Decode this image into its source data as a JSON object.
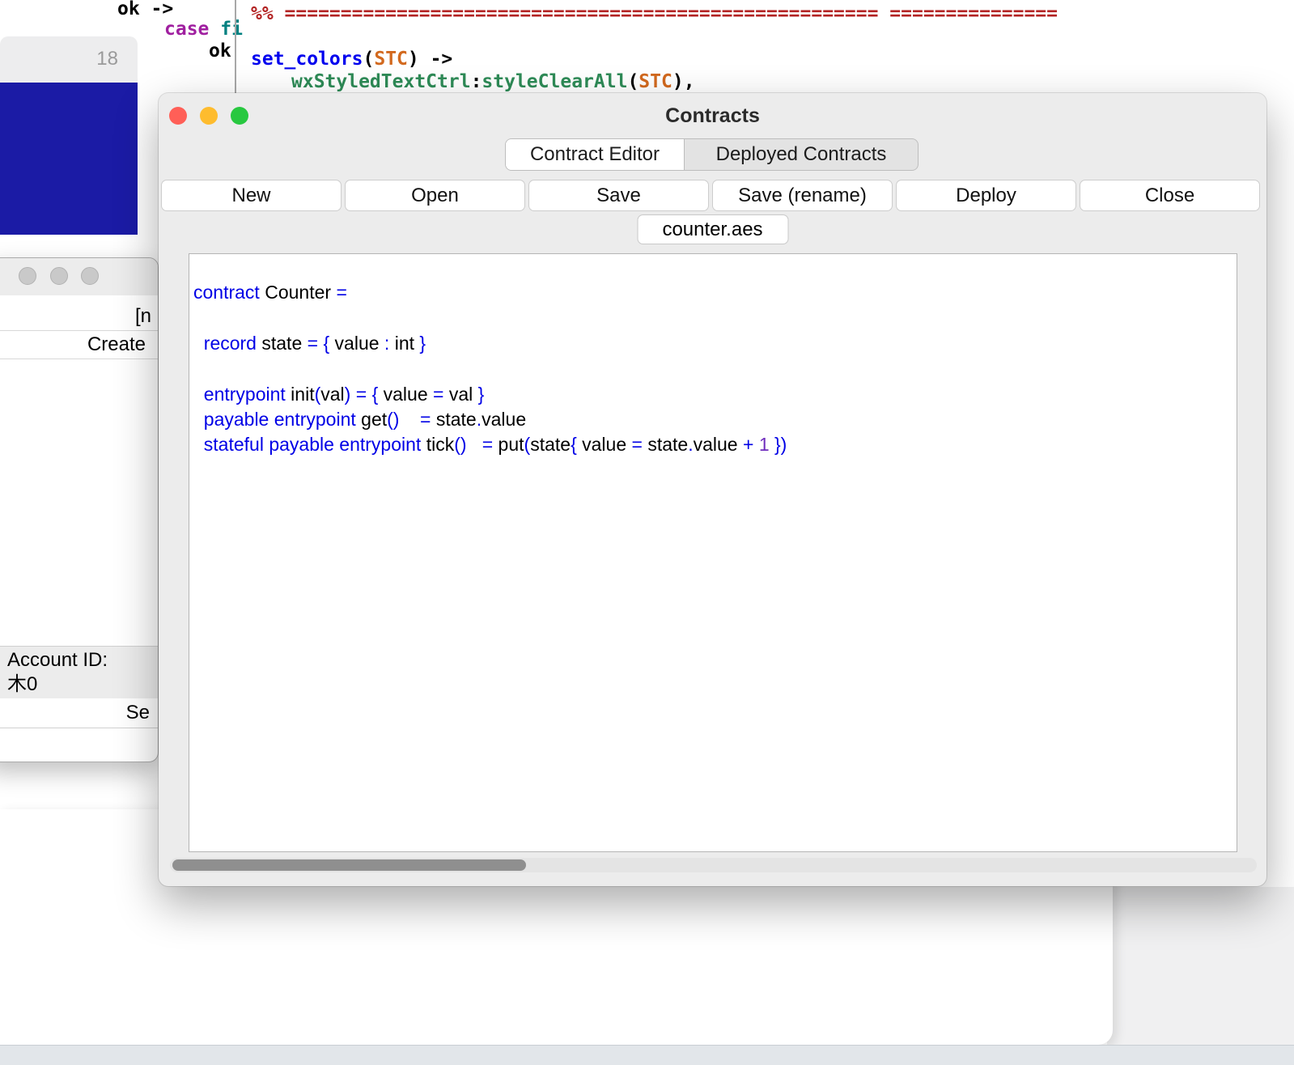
{
  "colors": {
    "sophia_keyword_operator": "#0000e6",
    "sophia_number": "#6f2dbd",
    "erlang_comment": "#b22222",
    "erlang_function": "#0000ee",
    "erlang_variable": "#d2691e",
    "erlang_module": "#2e8b57",
    "erlang_keyword": "#a020a0",
    "erlang_atom": "#008080",
    "traffic_red": "#ff5f57",
    "traffic_yellow": "#febc2e",
    "traffic_green": "#28c840",
    "navy_panel": "#1b1ba5"
  },
  "background_code": {
    "line_number": "18",
    "ok1": "ok ->",
    "ok2": "ok",
    "case_line": [
      {
        "t": "ekw",
        "s": "case"
      },
      {
        "t": "epl",
        "s": " "
      },
      {
        "t": "eatom",
        "s": "fi"
      }
    ],
    "comment_line": [
      {
        "t": "ecom",
        "s": "%% ===================================================== ==============="
      }
    ],
    "set_colors_line": [
      {
        "t": "efn",
        "s": "set_colors"
      },
      {
        "t": "epl",
        "s": "("
      },
      {
        "t": "evar",
        "s": "STC"
      },
      {
        "t": "epl",
        "s": ") ->"
      }
    ],
    "wx_call_line": [
      {
        "t": "emod",
        "s": "wxStyledTextCtrl"
      },
      {
        "t": "epl",
        "s": ":"
      },
      {
        "t": "emod",
        "s": "styleClearAll"
      },
      {
        "t": "epl",
        "s": "("
      },
      {
        "t": "evar",
        "s": "STC"
      },
      {
        "t": "epl",
        "s": "),"
      }
    ]
  },
  "accounts": {
    "partial_text": "[n",
    "create_label": "Create",
    "account_id_label": "Account ID:",
    "account_id_value": "木0",
    "send_partial_label": "Se"
  },
  "contracts": {
    "title": "Contracts",
    "tab_editor": "Contract Editor",
    "tab_deployed": "Deployed Contracts",
    "toolbar": {
      "new": "New",
      "open": "Open",
      "save": "Save",
      "save_rename": "Save (rename)",
      "deploy": "Deploy",
      "close": "Close"
    },
    "file_tab": "counter.aes",
    "code": [
      [
        {
          "t": "kw",
          "s": "contract"
        },
        {
          "t": "pl",
          "s": " Counter "
        },
        {
          "t": "op",
          "s": "="
        }
      ],
      [],
      [
        {
          "t": "pl",
          "s": "  "
        },
        {
          "t": "kw",
          "s": "record"
        },
        {
          "t": "pl",
          "s": " state "
        },
        {
          "t": "op",
          "s": "="
        },
        {
          "t": "pl",
          "s": " "
        },
        {
          "t": "op",
          "s": "{"
        },
        {
          "t": "pl",
          "s": " value "
        },
        {
          "t": "op",
          "s": ":"
        },
        {
          "t": "pl",
          "s": " int "
        },
        {
          "t": "op",
          "s": "}"
        }
      ],
      [],
      [
        {
          "t": "pl",
          "s": "  "
        },
        {
          "t": "kw",
          "s": "entrypoint"
        },
        {
          "t": "pl",
          "s": " init"
        },
        {
          "t": "op",
          "s": "("
        },
        {
          "t": "pl",
          "s": "val"
        },
        {
          "t": "op",
          "s": ")"
        },
        {
          "t": "pl",
          "s": " "
        },
        {
          "t": "op",
          "s": "="
        },
        {
          "t": "pl",
          "s": " "
        },
        {
          "t": "op",
          "s": "{"
        },
        {
          "t": "pl",
          "s": " value "
        },
        {
          "t": "op",
          "s": "="
        },
        {
          "t": "pl",
          "s": " val "
        },
        {
          "t": "op",
          "s": "}"
        }
      ],
      [
        {
          "t": "pl",
          "s": "  "
        },
        {
          "t": "kw",
          "s": "payable"
        },
        {
          "t": "pl",
          "s": " "
        },
        {
          "t": "kw",
          "s": "entrypoint"
        },
        {
          "t": "pl",
          "s": " get"
        },
        {
          "t": "op",
          "s": "()"
        },
        {
          "t": "pl",
          "s": "    "
        },
        {
          "t": "op",
          "s": "="
        },
        {
          "t": "pl",
          "s": " state"
        },
        {
          "t": "op",
          "s": "."
        },
        {
          "t": "pl",
          "s": "value"
        }
      ],
      [
        {
          "t": "pl",
          "s": "  "
        },
        {
          "t": "kw",
          "s": "stateful"
        },
        {
          "t": "pl",
          "s": " "
        },
        {
          "t": "kw",
          "s": "payable"
        },
        {
          "t": "pl",
          "s": " "
        },
        {
          "t": "kw",
          "s": "entrypoint"
        },
        {
          "t": "pl",
          "s": " tick"
        },
        {
          "t": "op",
          "s": "()"
        },
        {
          "t": "pl",
          "s": "   "
        },
        {
          "t": "op",
          "s": "="
        },
        {
          "t": "pl",
          "s": " put"
        },
        {
          "t": "op",
          "s": "("
        },
        {
          "t": "pl",
          "s": "state"
        },
        {
          "t": "op",
          "s": "{"
        },
        {
          "t": "pl",
          "s": " value "
        },
        {
          "t": "op",
          "s": "="
        },
        {
          "t": "pl",
          "s": " state"
        },
        {
          "t": "op",
          "s": "."
        },
        {
          "t": "pl",
          "s": "value "
        },
        {
          "t": "op",
          "s": "+"
        },
        {
          "t": "pl",
          "s": " "
        },
        {
          "t": "num",
          "s": "1"
        },
        {
          "t": "pl",
          "s": " "
        },
        {
          "t": "op",
          "s": "})"
        }
      ]
    ]
  }
}
